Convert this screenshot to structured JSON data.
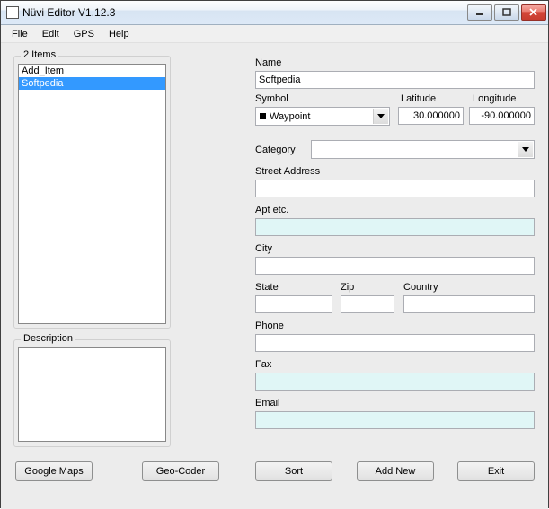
{
  "window": {
    "title": "Nüvi Editor V1.12.3"
  },
  "menu": {
    "file": "File",
    "edit": "Edit",
    "gps": "GPS",
    "help": "Help"
  },
  "left": {
    "items_header": "2 Items",
    "list": [
      "Add_Item",
      "Softpedia"
    ],
    "description_label": "Description",
    "description_value": ""
  },
  "form": {
    "name_label": "Name",
    "name_value": "Softpedia",
    "symbol_label": "Symbol",
    "symbol_value": "Waypoint",
    "latitude_label": "Latitude",
    "latitude_value": "30.000000",
    "longitude_label": "Longitude",
    "longitude_value": "-90.000000",
    "category_label": "Category",
    "category_value": "",
    "street_label": "Street Address",
    "street_value": "",
    "apt_label": "Apt etc.",
    "apt_value": "",
    "city_label": "City",
    "city_value": "",
    "state_label": "State",
    "state_value": "",
    "zip_label": "Zip",
    "zip_value": "",
    "country_label": "Country",
    "country_value": "",
    "phone_label": "Phone",
    "phone_value": "",
    "fax_label": "Fax",
    "fax_value": "",
    "email_label": "Email",
    "email_value": ""
  },
  "buttons": {
    "google_maps": "Google Maps",
    "geo_coder": "Geo-Coder",
    "sort": "Sort",
    "add_new": "Add New",
    "exit": "Exit"
  }
}
